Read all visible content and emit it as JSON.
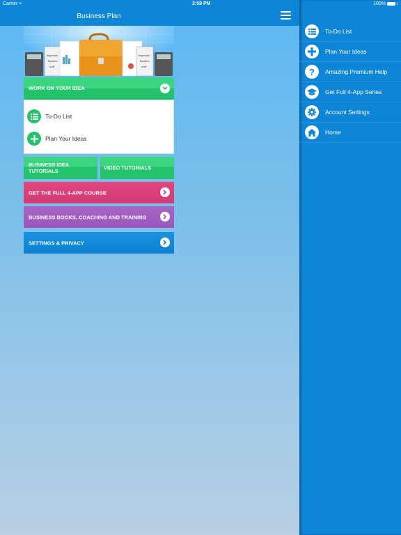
{
  "status_bar": {
    "carrier": "Carrier",
    "time": "2:59 PM",
    "battery": "100%"
  },
  "nav": {
    "title": "Business Plan",
    "menu_icon": "hamburger-icon"
  },
  "work_card": {
    "title": "WORK ON YOUR IDEA",
    "items": [
      {
        "label": "To-Do List",
        "icon": "list-icon"
      },
      {
        "label": "Plan Your Ideas",
        "icon": "plus-icon"
      }
    ]
  },
  "tiles": {
    "business_idea_tutorials": "BUSINESS IDEA TUTORIALS",
    "video_tutorials": "VIDEO TUTORIALS",
    "full_course": "GET THE FULL 4-APP COURSE",
    "books": "BUSINESS BOOKS, COACHING AND TRAINING",
    "settings": "SETTINGS & PRIVACY"
  },
  "drawer": {
    "items": [
      {
        "label": "To-Do List",
        "icon": "list-icon"
      },
      {
        "label": "Plan Your Ideas",
        "icon": "plus-icon"
      },
      {
        "label": "Amazing Premium Help",
        "icon": "question-icon"
      },
      {
        "label": "Get Full 4-App Series",
        "icon": "graduation-cap-icon"
      },
      {
        "label": "Account Settings",
        "icon": "gear-icon"
      },
      {
        "label": "Home",
        "icon": "home-icon"
      }
    ]
  },
  "colors": {
    "nav_blue": "#0e86d8",
    "green": "#22c36a",
    "pink": "#d33b74",
    "purple": "#9a55bb",
    "blue": "#0c80d0"
  }
}
